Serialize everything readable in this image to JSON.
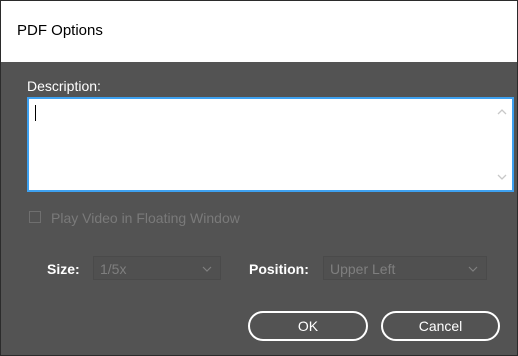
{
  "dialog": {
    "title": "PDF Options"
  },
  "description": {
    "label": "Description:",
    "value": ""
  },
  "floating_window": {
    "label": "Play Video in Floating Window",
    "checked": false,
    "enabled": false
  },
  "size": {
    "label": "Size:",
    "value": "1/5x"
  },
  "position": {
    "label": "Position:",
    "value": "Upper Left"
  },
  "buttons": {
    "ok": "OK",
    "cancel": "Cancel"
  },
  "icons": {
    "scroll_up": "chevron-up-icon",
    "scroll_down": "chevron-down-icon",
    "size_dropdown": "chevron-down-icon",
    "position_dropdown": "chevron-down-icon"
  },
  "colors": {
    "focus_border": "#3ea1f0",
    "dialog_background": "#535353",
    "disabled_text": "#7a7a7a"
  }
}
